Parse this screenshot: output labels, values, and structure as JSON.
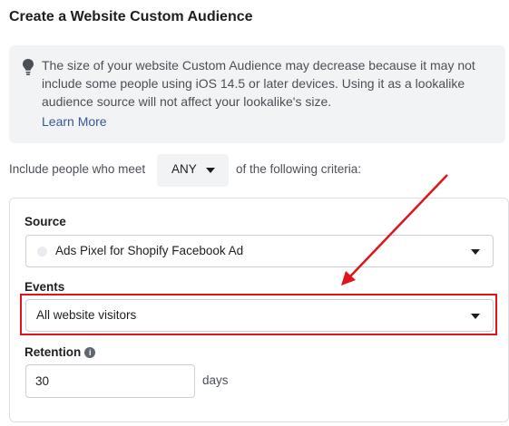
{
  "header": {
    "title": "Create a Website Custom Audience",
    "menu_icon": "kebab-menu-icon"
  },
  "info": {
    "icon": "lightbulb-icon",
    "text": "The size of your website Custom Audience may decrease because it may not include some people using iOS 14.5 or later devices. Using it as a lookalike audience source will not affect your lookalike's size.",
    "link": "Learn More"
  },
  "criteria": {
    "prefix": "Include people who meet",
    "match_value": "ANY",
    "suffix": "of the following criteria:"
  },
  "form": {
    "source_label": "Source",
    "source_value": "Ads Pixel for Shopify Facebook Ad",
    "events_label": "Events",
    "events_value": "All website visitors",
    "retention_label": "Retention",
    "retention_value": "30",
    "retention_unit": "days"
  },
  "annotation": {
    "color": "#e0141b"
  }
}
